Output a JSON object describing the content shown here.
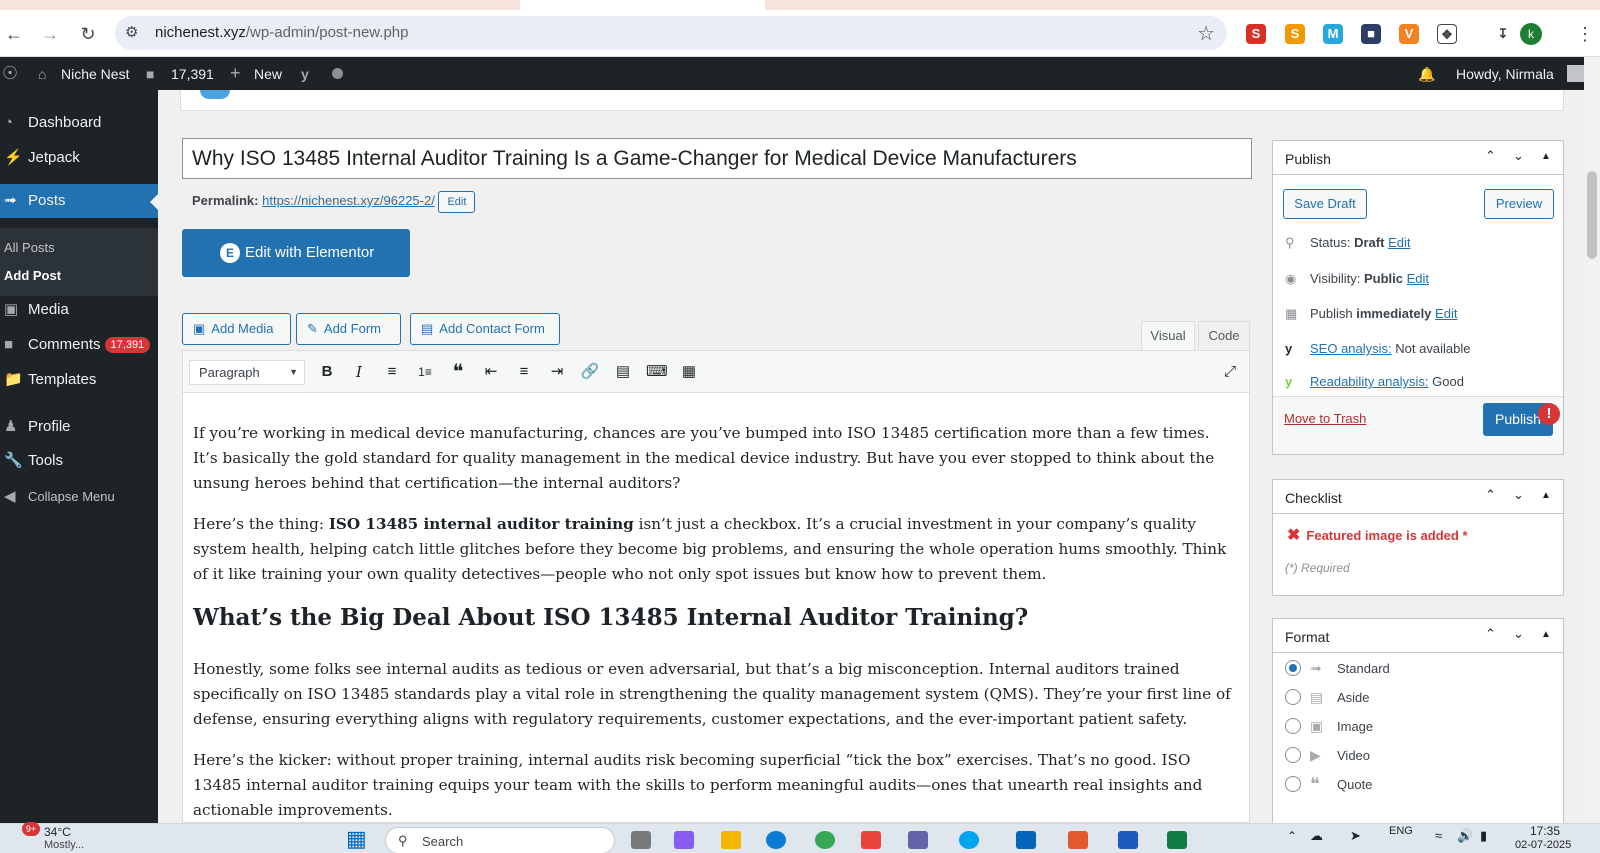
{
  "browser": {
    "url_host": "nichenest.xyz",
    "url_path": "/wp-admin/post-new.php",
    "profile_initial": "k"
  },
  "adminbar": {
    "site_name": "Niche Nest",
    "comments_count": "17,391",
    "new_label": "New",
    "howdy": "Howdy, Nirmala"
  },
  "sidebar": {
    "items": [
      {
        "label": "Dashboard",
        "icon": "dashboard-icon"
      },
      {
        "label": "Jetpack",
        "icon": "jetpack-icon"
      },
      {
        "label": "Posts",
        "icon": "pin-icon"
      },
      {
        "label": "Media",
        "icon": "media-icon"
      },
      {
        "label": "Comments",
        "icon": "comment-icon"
      },
      {
        "label": "Templates",
        "icon": "folder-icon"
      },
      {
        "label": "Profile",
        "icon": "user-icon"
      },
      {
        "label": "Tools",
        "icon": "wrench-icon"
      },
      {
        "label": "Collapse Menu",
        "icon": "collapse-icon"
      }
    ],
    "submenu": [
      "All Posts",
      "Add Post"
    ],
    "comments_badge": "17,391"
  },
  "editor": {
    "title": "Why ISO 13485 Internal Auditor Training Is a Game-Changer for Medical Device Manufacturers",
    "permalink_label": "Permalink:",
    "permalink_url": "https://nichenest.xyz/96225-2/",
    "permalink_edit": "Edit",
    "elementor_label": "Edit with Elementor",
    "add_media": "Add Media",
    "add_form": "Add Form",
    "add_contact_form": "Add Contact Form",
    "tab_visual": "Visual",
    "tab_code": "Code",
    "format_value": "Paragraph",
    "p1": "If you’re working in medical device manufacturing, chances are you’ve bumped into ISO 13485 certification more than a few times. It’s basically the gold standard for quality management in the medical device industry. But have you ever stopped to think about the unsung heroes behind that certification—the internal auditors?",
    "p2_pre": "Here’s the thing: ",
    "p2_bold": "ISO 13485 internal auditor training",
    "p2_post": " isn’t just a checkbox. It’s a crucial investment in your company’s quality system health, helping catch little glitches before they become big problems, and ensuring the whole operation hums smoothly. Think of it like training your own quality detectives—people who not only spot issues but know how to prevent them.",
    "h2": "What’s the Big Deal About ISO 13485 Internal Auditor Training?",
    "p3": "Honestly, some folks see internal audits as tedious or even adversarial, but that’s a big misconception. Internal auditors trained specifically on ISO 13485 standards play a vital role in strengthening the quality management system (QMS). They’re your first line of defense, ensuring everything aligns with regulatory requirements, customer expectations, and the ever-important patient safety.",
    "p4": "Here’s the kicker: without proper training, internal audits risk becoming superficial “tick the box” exercises. That’s no good. ISO 13485 internal auditor training equips your team with the skills to perform meaningful audits—ones that unearth real insights and actionable improvements."
  },
  "publish": {
    "title": "Publish",
    "save_draft": "Save Draft",
    "preview": "Preview",
    "status_label": "Status:",
    "status_value": "Draft",
    "visibility_label": "Visibility:",
    "visibility_value": "Public",
    "publish_label": "Publish",
    "publish_value": "immediately",
    "edit": "Edit",
    "seo_label": "SEO analysis:",
    "seo_value": "Not available",
    "readability_label": "Readability analysis:",
    "readability_value": "Good",
    "trash": "Move to Trash",
    "publish_btn": "Publish",
    "alert": "!"
  },
  "checklist": {
    "title": "Checklist",
    "item": "Featured image is added *",
    "required": "(*) Required"
  },
  "format": {
    "title": "Format",
    "options": [
      "Standard",
      "Aside",
      "Image",
      "Video",
      "Quote"
    ],
    "selected": "Standard"
  },
  "taskbar": {
    "weather_badge": "9+",
    "temp": "34°C",
    "weather_sub": "Mostly...",
    "search": "Search",
    "lang": "ENG",
    "time": "17:35",
    "date": "02-07-2025"
  },
  "colors": {
    "wp_blue": "#2271b1",
    "admin_dark": "#1d2327",
    "danger": "#d63638"
  }
}
